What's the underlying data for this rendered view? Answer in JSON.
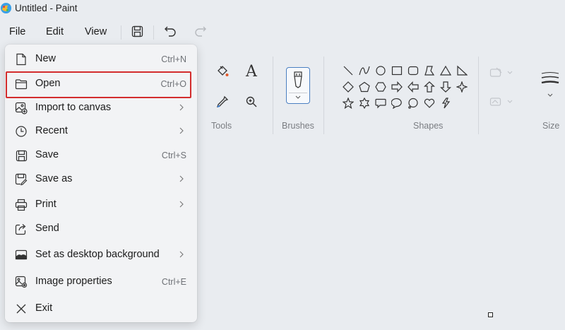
{
  "window": {
    "title": "Untitled - Paint"
  },
  "menubar": {
    "file": "File",
    "edit": "Edit",
    "view": "View"
  },
  "quick_access": {
    "save_icon": "save-icon",
    "undo_icon": "undo-icon",
    "redo_icon": "redo-icon"
  },
  "ribbon": {
    "tools_label": "Tools",
    "brushes_label": "Brushes",
    "shapes_label": "Shapes",
    "size_label": "Size",
    "text_tool_glyph": "A"
  },
  "file_menu": {
    "items": [
      {
        "label": "New",
        "shortcut": "Ctrl+N",
        "submenu": false,
        "icon": "new-file-icon"
      },
      {
        "label": "Open",
        "shortcut": "Ctrl+O",
        "submenu": false,
        "icon": "folder-icon"
      },
      {
        "label": "Import to canvas",
        "shortcut": "",
        "submenu": true,
        "icon": "import-image-icon"
      },
      {
        "label": "Recent",
        "shortcut": "",
        "submenu": true,
        "icon": "clock-icon"
      },
      {
        "label": "Save",
        "shortcut": "Ctrl+S",
        "submenu": false,
        "icon": "save-icon"
      },
      {
        "label": "Save as",
        "shortcut": "",
        "submenu": true,
        "icon": "save-as-icon"
      },
      {
        "label": "Print",
        "shortcut": "",
        "submenu": true,
        "icon": "printer-icon"
      },
      {
        "label": "Send",
        "shortcut": "",
        "submenu": false,
        "icon": "share-icon"
      },
      {
        "label": "Set as desktop background",
        "shortcut": "",
        "submenu": true,
        "icon": "desktop-background-icon"
      },
      {
        "label": "Image properties",
        "shortcut": "Ctrl+E",
        "submenu": false,
        "icon": "image-properties-icon"
      },
      {
        "label": "Exit",
        "shortcut": "",
        "submenu": false,
        "icon": "close-icon"
      }
    ]
  },
  "colors": {
    "highlight": "#d32d2d",
    "accent": "#4a7fc1",
    "background": "#e9ecf0",
    "menu": "#f2f3f5"
  }
}
